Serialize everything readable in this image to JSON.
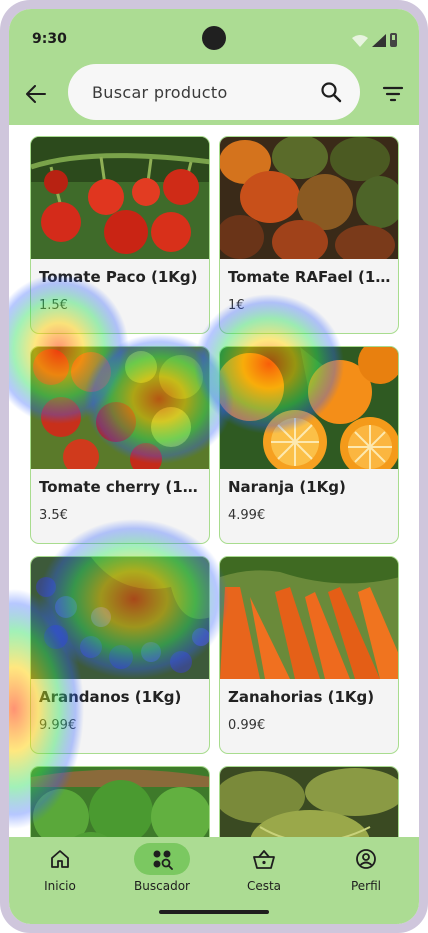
{
  "status_bar": {
    "time": "9:30"
  },
  "search": {
    "placeholder": "Buscar producto"
  },
  "products": [
    {
      "name": "Tomate Paco (1Kg)",
      "price": "1.5€",
      "image": "cherry-tomatoes-vine"
    },
    {
      "name": "Tomate RAFael (1K...",
      "price": "1€",
      "image": "raf-tomatoes"
    },
    {
      "name": "Tomate cherry (1K...",
      "price": "3.5€",
      "image": "cherry-tomatoes"
    },
    {
      "name": "Naranja (1Kg)",
      "price": "4.99€",
      "image": "oranges"
    },
    {
      "name": "Arandanos (1Kg)",
      "price": "9.99€",
      "image": "blueberries"
    },
    {
      "name": "Zanahorias (1Kg)",
      "price": "0.99€",
      "image": "carrots"
    },
    {
      "name": "",
      "price": "",
      "image": "lettuce"
    },
    {
      "name": "",
      "price": "",
      "image": "melons"
    }
  ],
  "nav": {
    "items": [
      {
        "label": "Inicio",
        "icon": "home-icon"
      },
      {
        "label": "Buscador",
        "icon": "search-grid-icon",
        "active": true
      },
      {
        "label": "Cesta",
        "icon": "basket-icon"
      },
      {
        "label": "Perfil",
        "icon": "profile-icon"
      }
    ]
  },
  "colors": {
    "header_green": "#acdc93",
    "active_pill": "#7bc861",
    "card_border": "#a8dc8e"
  }
}
